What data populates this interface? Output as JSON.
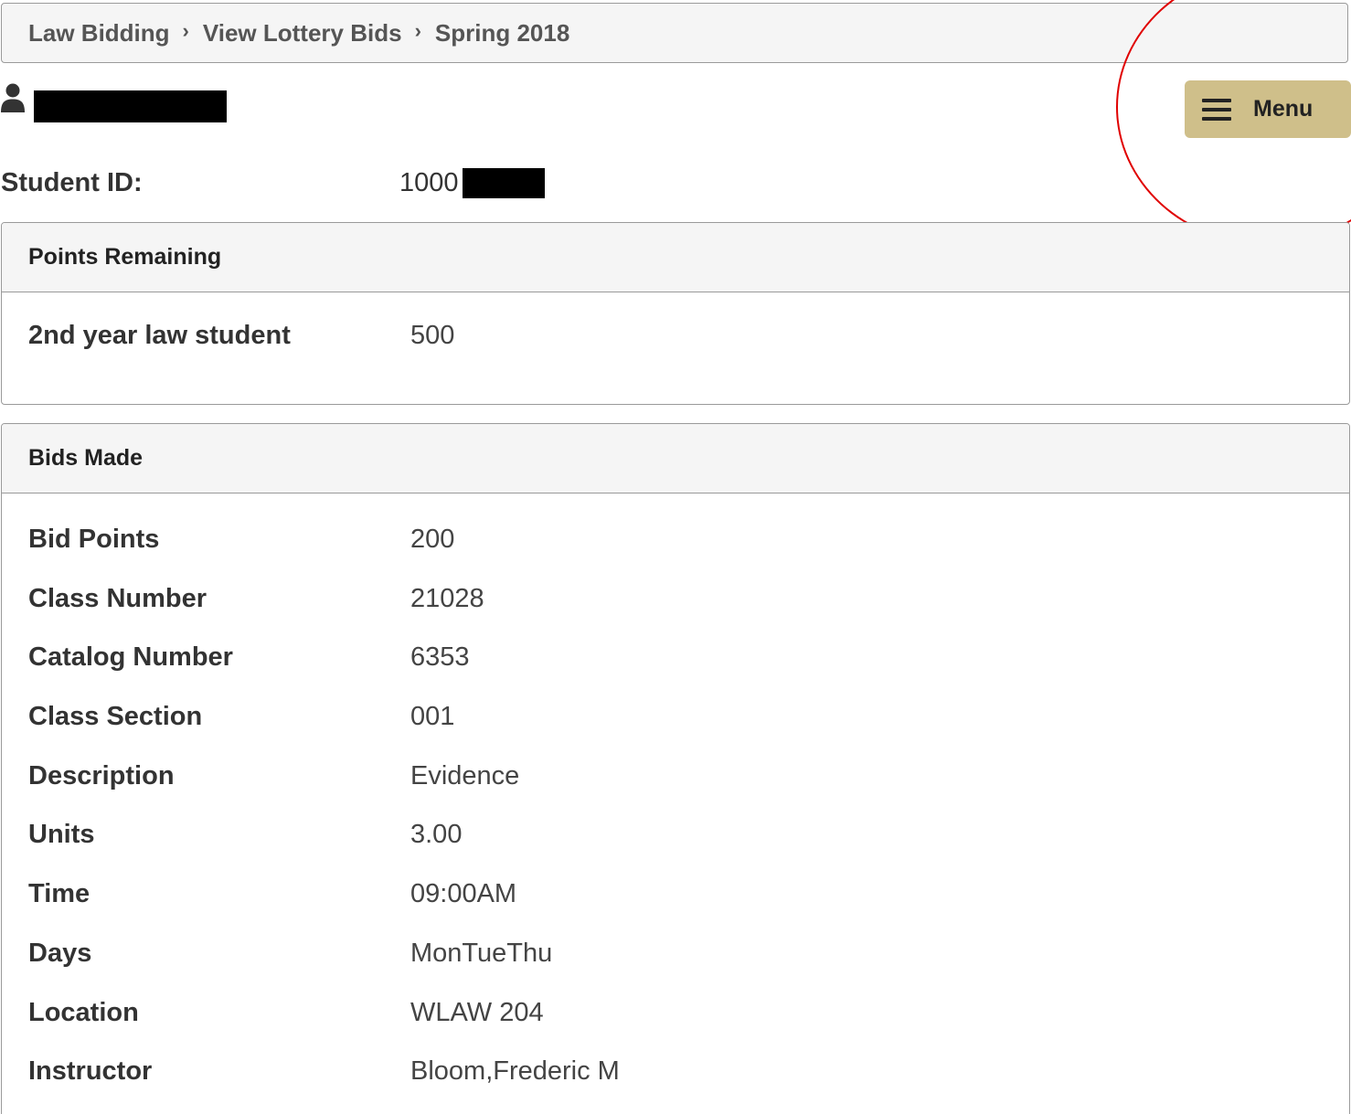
{
  "breadcrumb": {
    "items": [
      {
        "label": "Law Bidding"
      },
      {
        "label": "View Lottery Bids"
      },
      {
        "label": "Spring 2018"
      }
    ],
    "separator": "›"
  },
  "header": {
    "menu_label": "Menu"
  },
  "student": {
    "id_label": "Student ID:",
    "id_visible_prefix": "1000"
  },
  "points_panel": {
    "title": "Points Remaining",
    "rows": [
      {
        "label": "2nd year law student",
        "value": "500"
      }
    ]
  },
  "bids_panel": {
    "title": "Bids Made",
    "rows": [
      {
        "label": "Bid Points",
        "value": "200"
      },
      {
        "label": "Class Number",
        "value": "21028"
      },
      {
        "label": "Catalog Number",
        "value": "6353"
      },
      {
        "label": "Class Section",
        "value": "001"
      },
      {
        "label": "Description",
        "value": "Evidence"
      },
      {
        "label": "Units",
        "value": "3.00"
      },
      {
        "label": "Time",
        "value": "09:00AM"
      },
      {
        "label": "Days",
        "value": "MonTueThu"
      },
      {
        "label": "Location",
        "value": "WLAW 204"
      },
      {
        "label": "Instructor",
        "value": "Bloom,Frederic M"
      }
    ]
  },
  "colors": {
    "menu_button": "#cfbf8a",
    "annotation": "#e00000",
    "panel_heading": "#f5f5f5"
  },
  "icons": {
    "user": "user-icon",
    "menu": "hamburger-icon"
  }
}
